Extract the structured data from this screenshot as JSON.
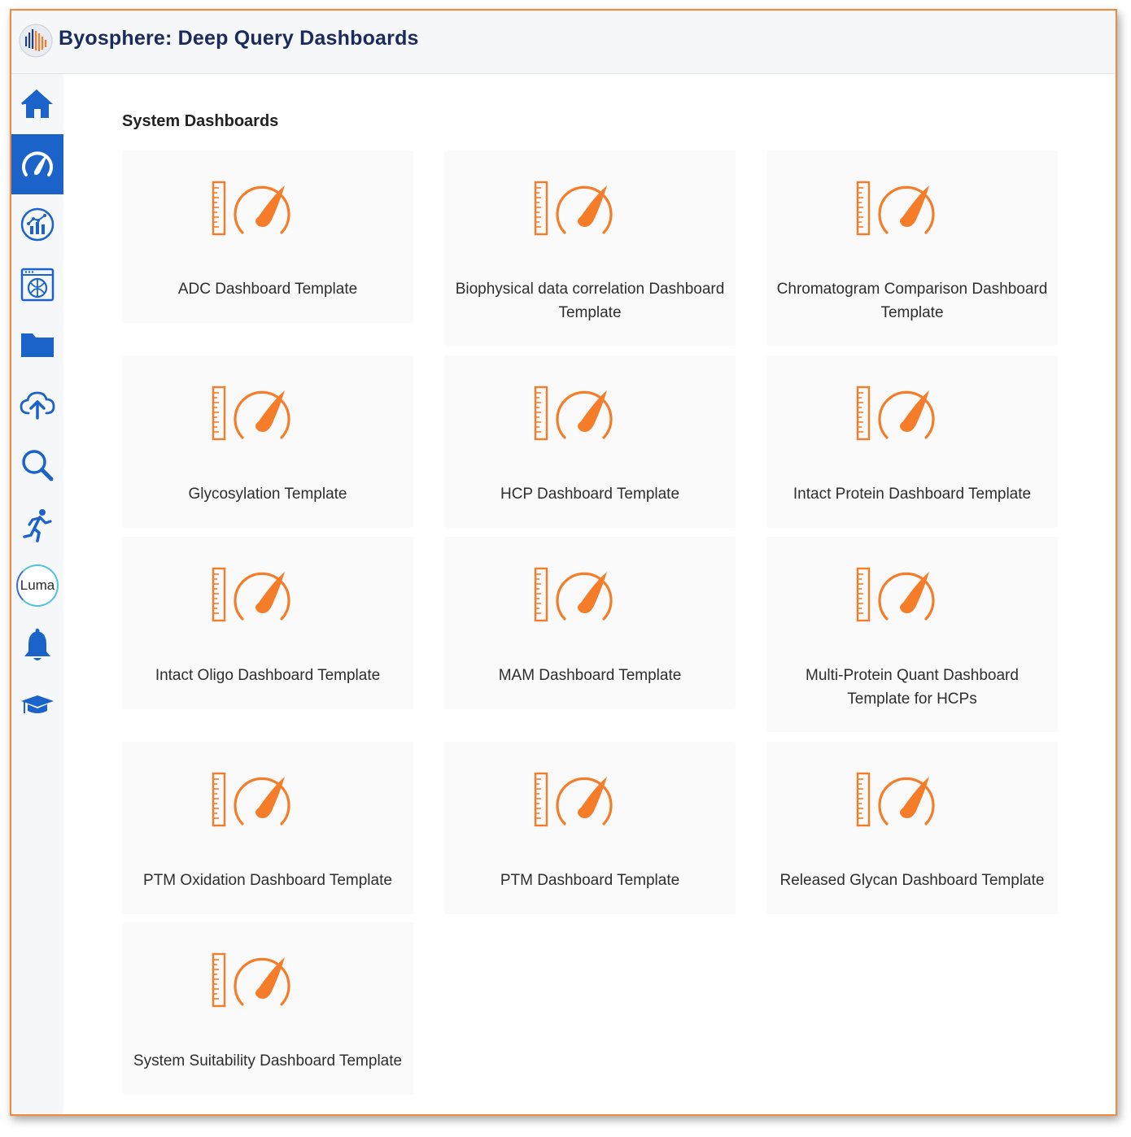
{
  "header": {
    "title": "Byosphere: Deep Query Dashboards"
  },
  "sidebar": {
    "items": [
      {
        "icon": "home-icon"
      },
      {
        "icon": "dashboard-gauge-icon",
        "active": true
      },
      {
        "icon": "analytics-icon"
      },
      {
        "icon": "browser-protein-icon"
      },
      {
        "icon": "folder-icon"
      },
      {
        "icon": "cloud-upload-icon"
      },
      {
        "icon": "search-icon"
      },
      {
        "icon": "running-person-icon"
      },
      {
        "icon": "luma-badge",
        "label": "Luma"
      },
      {
        "icon": "bell-icon"
      },
      {
        "icon": "graduation-cap-icon"
      }
    ]
  },
  "main": {
    "section_title": "System Dashboards",
    "card_icon": "dashboard-template-icon",
    "cards": [
      {
        "label": "ADC Dashboard Template"
      },
      {
        "label": "Biophysical data correlation Dashboard Template"
      },
      {
        "label": "Chromatogram Comparison Dashboard Template"
      },
      {
        "label": "Glycosylation Template"
      },
      {
        "label": "HCP Dashboard Template"
      },
      {
        "label": "Intact Protein Dashboard Template"
      },
      {
        "label": "Intact Oligo Dashboard Template"
      },
      {
        "label": "MAM Dashboard Template"
      },
      {
        "label": "Multi-Protein Quant Dashboard Template for HCPs"
      },
      {
        "label": "PTM Oxidation Dashboard Template"
      },
      {
        "label": "PTM Dashboard Template"
      },
      {
        "label": "Released Glycan Dashboard Template"
      },
      {
        "label": "System Suitability Dashboard Template"
      }
    ]
  },
  "colors": {
    "accent_orange": "#f57c28",
    "nav_blue": "#1b63c9",
    "title_navy": "#1a2a5c",
    "border_orange": "#f08a3e"
  }
}
